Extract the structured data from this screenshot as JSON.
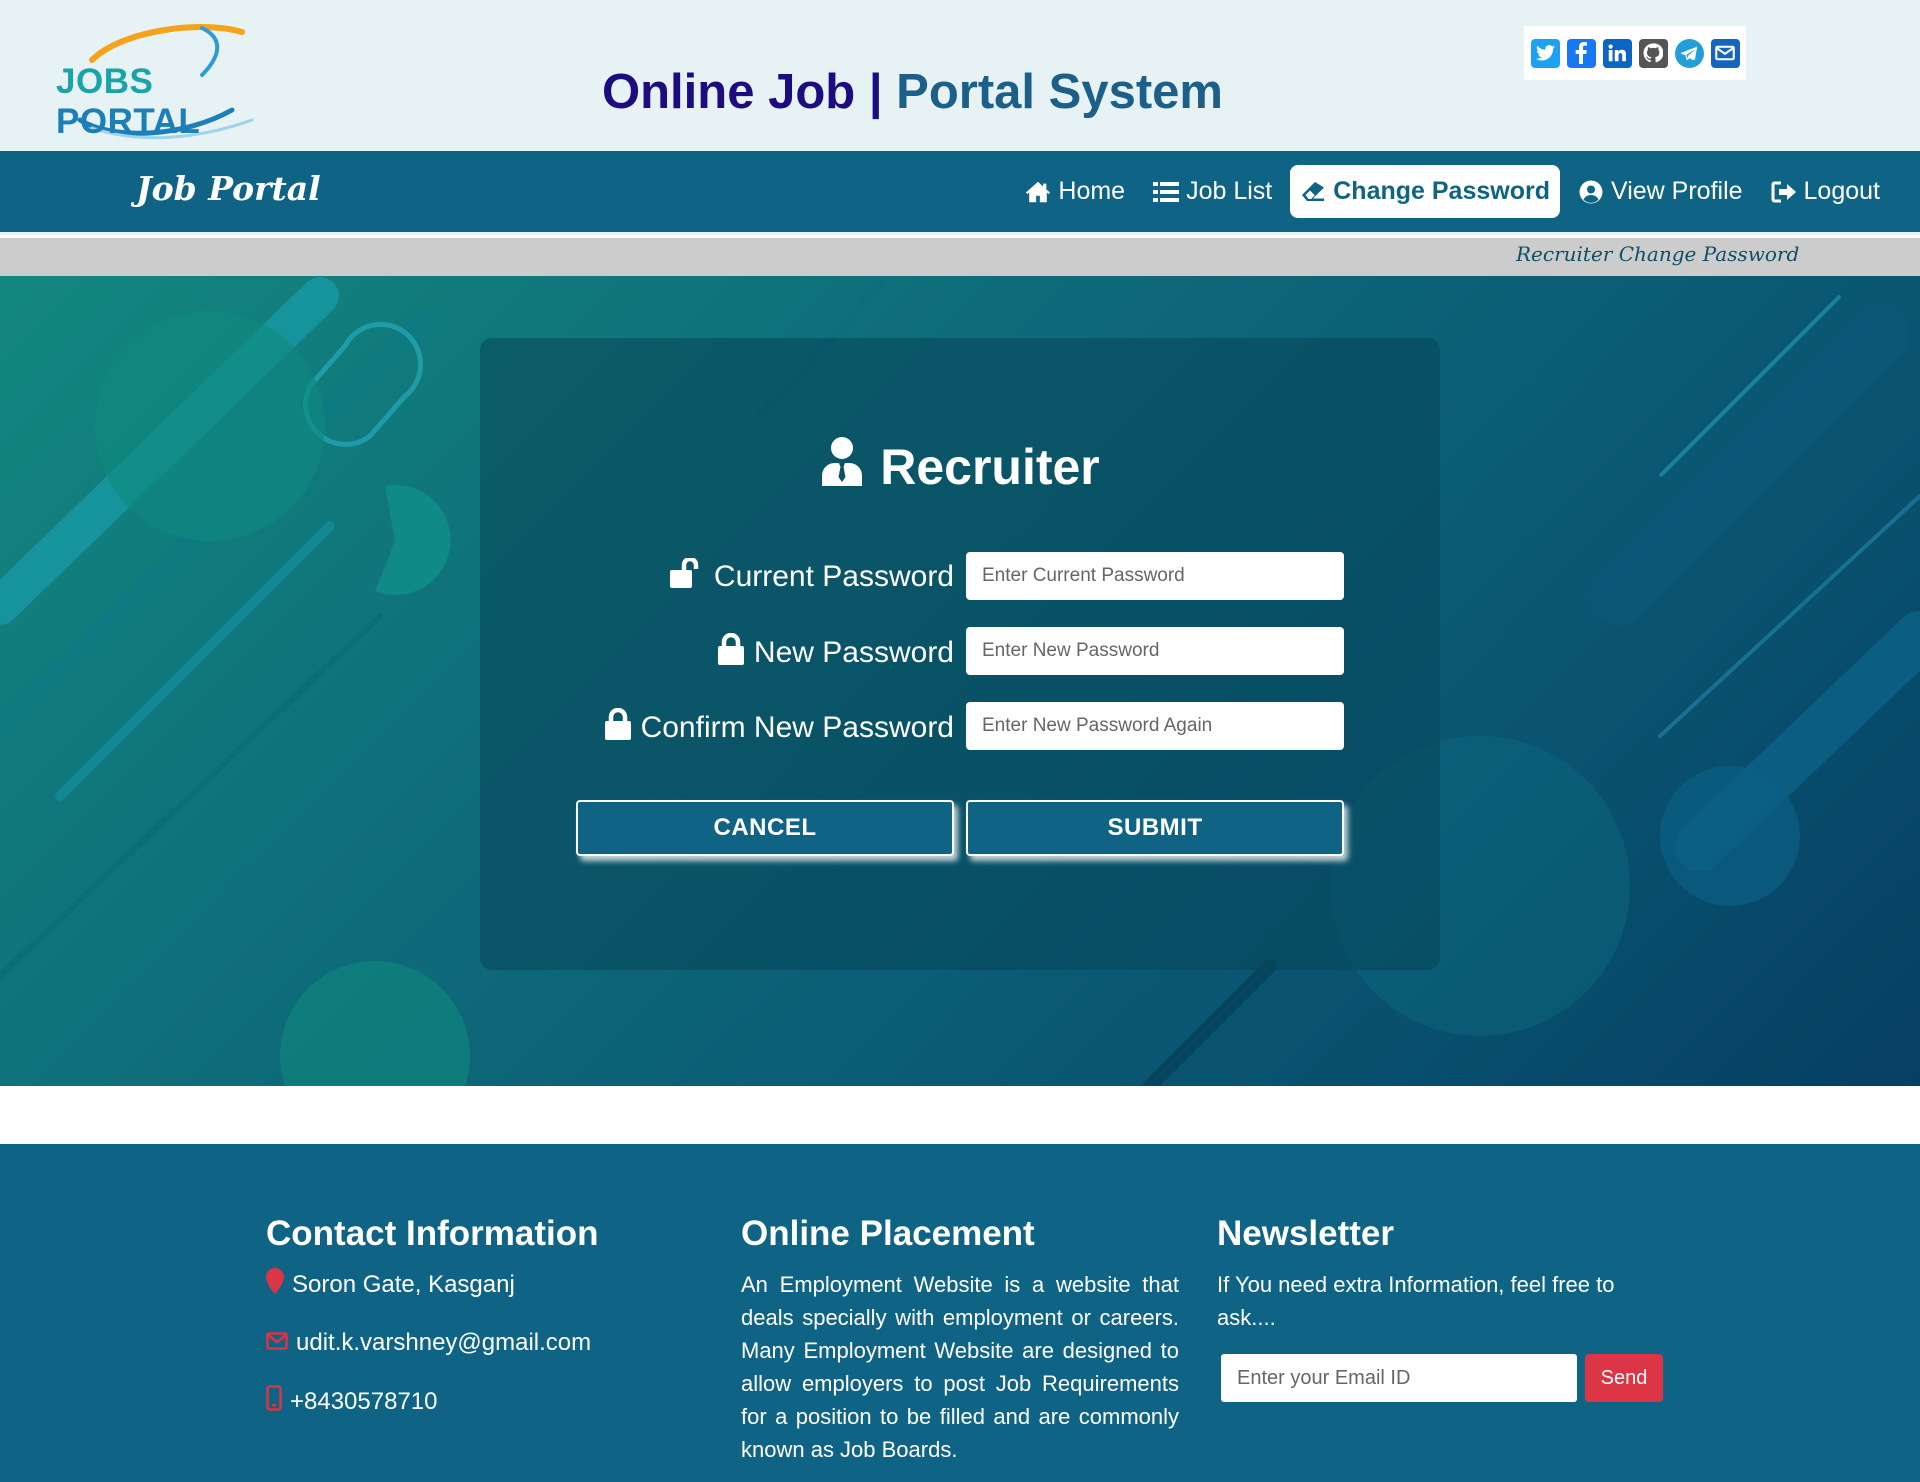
{
  "header": {
    "logo_text_1": "JOBS",
    "logo_text_2": "PORTAL",
    "title_part1": "Online Job",
    "title_separator": "|",
    "title_part2": "Portal System",
    "social_icons": [
      "twitter-icon",
      "facebook-icon",
      "linkedin-icon",
      "github-icon",
      "telegram-icon",
      "email-icon"
    ],
    "social_colors": [
      "#1da1f2",
      "#1877f2",
      "#0a66c2",
      "#555555",
      "#229ed9",
      "#1565c0"
    ]
  },
  "navbar": {
    "brand": "Job Portal",
    "items": [
      {
        "label": "Home",
        "icon": "home-icon",
        "active": false
      },
      {
        "label": "Job List",
        "icon": "list-icon",
        "active": false
      },
      {
        "label": "Change Password",
        "icon": "eraser-icon",
        "active": true
      },
      {
        "label": "View Profile",
        "icon": "user-circle-icon",
        "active": false
      },
      {
        "label": "Logout",
        "icon": "logout-icon",
        "active": false
      }
    ]
  },
  "breadcrumb": "Recruiter Change Password",
  "form": {
    "title": "Recruiter",
    "fields": [
      {
        "label": "Current Password",
        "placeholder": "Enter Current Password",
        "icon": "unlock-icon"
      },
      {
        "label": "New Password",
        "placeholder": "Enter New Password",
        "icon": "lock-icon"
      },
      {
        "label": "Confirm New Password",
        "placeholder": "Enter New Password Again",
        "icon": "lock-icon"
      }
    ],
    "cancel_label": "CANCEL",
    "submit_label": "SUBMIT"
  },
  "footer": {
    "contact": {
      "heading": "Contact Information",
      "address": "Soron Gate, Kasganj",
      "email": "udit.k.varshney@gmail.com",
      "phone": "+8430578710"
    },
    "placement": {
      "heading": "Online Placement",
      "text": "An Employment Website is a website that deals specially with employment or careers. Many Employment Website are designed to allow employers to post Job Requirements for a position to be filled and are commonly known as Job Boards."
    },
    "newsletter": {
      "heading": "Newsletter",
      "text": "If You need extra Information, feel free to ask....",
      "placeholder": "Enter your Email ID",
      "send_label": "Send"
    }
  },
  "colors": {
    "primary": "#0f6485",
    "header_bg": "#e6f2f3",
    "title_dark": "#1d0c80",
    "title_blue": "#1c5f88",
    "danger": "#dc3545"
  }
}
